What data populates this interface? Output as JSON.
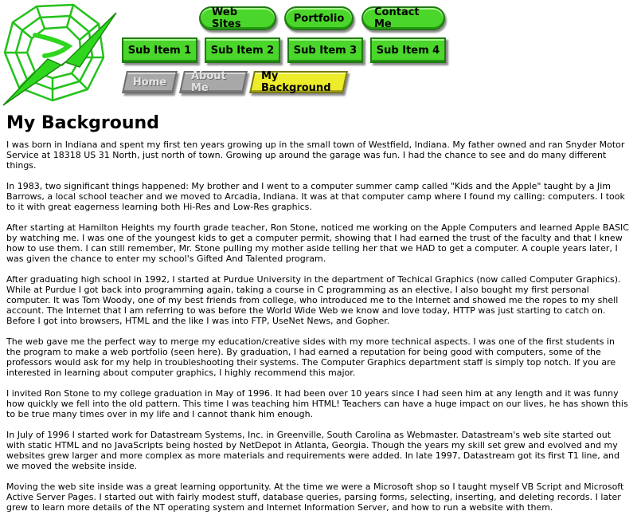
{
  "nav": {
    "top": [
      {
        "label": "Web Sites"
      },
      {
        "label": "Portfolio"
      },
      {
        "label": "Contact Me"
      }
    ],
    "sub": [
      {
        "label": "Sub Item 1"
      },
      {
        "label": "Sub Item 2"
      },
      {
        "label": "Sub Item 3"
      },
      {
        "label": "Sub Item 4"
      }
    ],
    "breadcrumb": [
      {
        "label": "Home"
      },
      {
        "label": "About Me"
      },
      {
        "label": "My Background"
      }
    ]
  },
  "colors": {
    "button_green": "#4ad62a",
    "active_yellow": "#ecec2a",
    "inactive_gray": "#a8a8a8"
  },
  "page": {
    "title": "My Background",
    "paragraphs": [
      "I was born in Indiana and spent my first ten years growing up in the small town of Westfield, Indiana. My father owned and ran Snyder Motor Service at 18318 US 31 North, just north of town. Growing up around the garage was fun. I had the chance to see and do many different things.",
      "In 1983, two significant things happened: My brother and I went to a computer summer camp called \"Kids and the Apple\" taught by a Jim Barrows, a local school teacher and we moved to Arcadia, Indiana. It was at that computer camp where I found my calling: computers. I took to it with great eagerness learning both Hi-Res and Low-Res graphics.",
      "After starting at Hamilton Heights my fourth grade teacher, Ron Stone, noticed me working on the Apple Computers and learned Apple BASIC by watching me. I was one of the youngest kids to get a computer permit, showing that I had earned the trust of the faculty and that I knew how to use them. I can still remember, Mr. Stone pulling my mother aside telling her that we HAD to get a computer. A couple years later, I was given the chance to enter my school's Gifted And Talented program.",
      "After graduating high school in 1992, I started at Purdue University in the department of Techical Graphics (now called Computer Graphics). While at Purdue I got back into programming again, taking a course in C programming as an elective, I also bought my first personal computer. It was Tom Woody, one of my best friends from college, who introduced me to the Internet and showed me the ropes to my shell account. The Internet that I am referring to was before the World Wide Web we know and love today, HTTP was just starting to catch on. Before I got into browsers, HTML and the like I was into FTP, UseNet News, and Gopher.",
      "The web gave me the perfect way to merge my education/creative sides with my more technical aspects. I was one of the first students in the program to make a web portfolio (seen here). By graduation, I had earned a reputation for being good with computers, some of the professors would ask for my help in troubleshooting their systems. The Computer Graphics department staff is simply top notch. If you are interested in learning about computer graphics, I highly recommend this major.",
      "I invited Ron Stone to my college graduation in May of 1996. It had been over 10 years since I had seen him at any length and it was funny how quickly we fell into the old pattern. This time I was teaching him HTML! Teachers can have a huge impact on our lives, he has shown this to be true many times over in my life and I cannot thank him enough.",
      "In July of 1996 I started work for Datastream Systems, Inc. in Greenville, South Carolina as Webmaster. Datastream's web site started out with static HTML and no JavaScripts being hosted by NetDepot in Atlanta, Georgia. Though the years my skill set grew and evolved and my websites grew larger and more complex as more materials and requirements were added. In late 1997, Datastream got its first T1 line, and we moved the website inside.",
      "Moving the web site inside was a great learning opportunity. At the time we were a Microsoft shop so I taught myself VB Script and Microsoft Active Server Pages. I started out with fairly modest stuff, database queries, parsing forms, selecting, inserting, and deleting records. I later grew to learn more details of the NT operating system and Internet Information Server, and how to run a website with them."
    ]
  }
}
